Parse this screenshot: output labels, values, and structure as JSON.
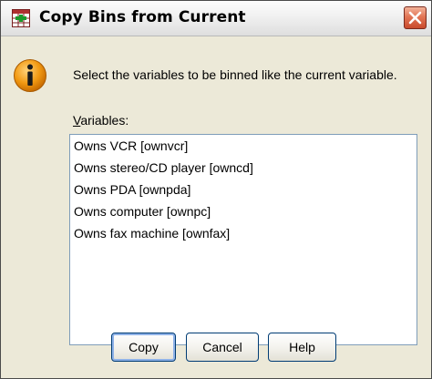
{
  "dialog": {
    "title": "Copy Bins from Current",
    "message": "Select the variables to be binned like the current variable.",
    "variables_label_accel": "V",
    "variables_label_rest": "ariables:",
    "variables": [
      "Owns VCR [ownvcr]",
      "Owns stereo/CD player [owncd]",
      "Owns PDA [ownpda]",
      "Owns computer [ownpc]",
      "Owns fax machine [ownfax]"
    ],
    "buttons": {
      "copy": "Copy",
      "cancel": "Cancel",
      "help": "Help"
    }
  },
  "icons": {
    "app": "spss-grid-icon",
    "close": "close-icon",
    "info": "info-icon"
  },
  "colors": {
    "dialog_bg": "#ece9d8",
    "close_red": "#e27555",
    "info_orange": "#f29a13",
    "listbox_border": "#7f9db9",
    "button_border": "#003c74"
  }
}
